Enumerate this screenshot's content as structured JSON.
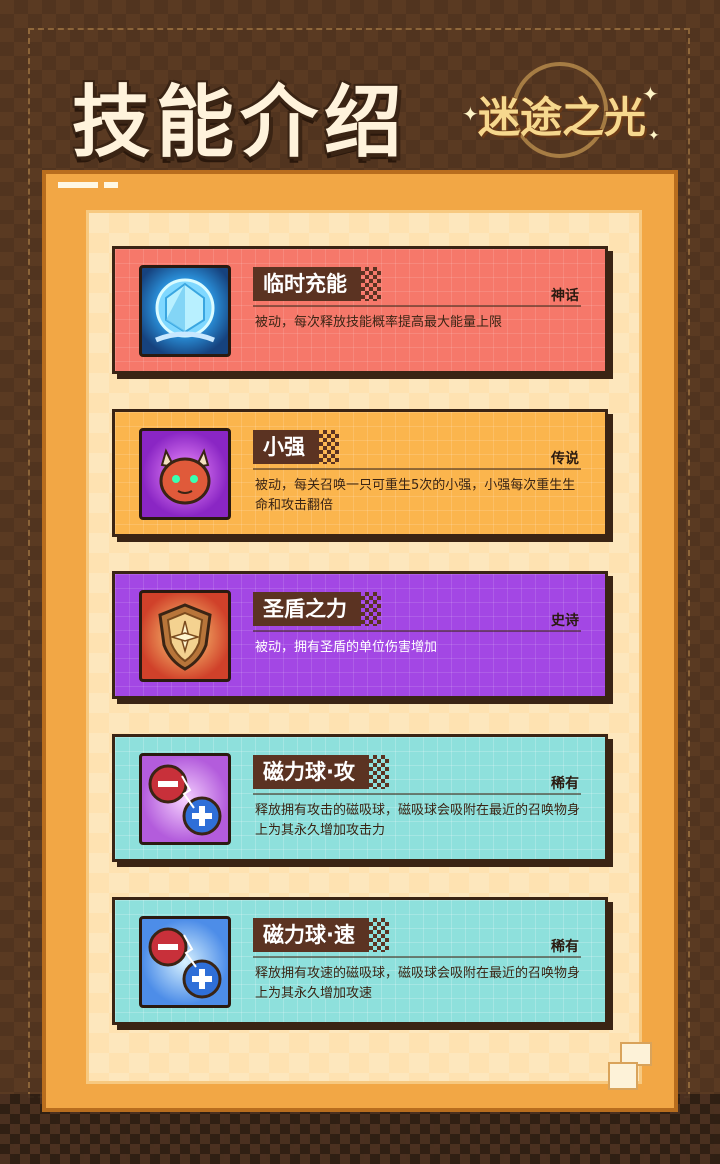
{
  "header": {
    "title": "技能介绍",
    "logo_text": "迷途之光"
  },
  "skills": [
    {
      "name": "临时充能",
      "rarity": "神话",
      "description": "被动，每次释放技能概率提高最大能量上限",
      "icon": "crystal-orb-icon"
    },
    {
      "name": "小强",
      "rarity": "传说",
      "description": "被动，每关召唤一只可重生5次的小强，小强每次重生生命和攻击翻倍",
      "icon": "horned-demon-icon"
    },
    {
      "name": "圣盾之力",
      "rarity": "史诗",
      "description": "被动，拥有圣盾的单位伤害增加",
      "icon": "holy-shield-icon"
    },
    {
      "name": "磁力球·攻",
      "rarity": "稀有",
      "description": "释放拥有攻击的磁吸球，磁吸球会吸附在最近的召唤物身上为其永久增加攻击力",
      "icon": "magnet-ball-attack-icon"
    },
    {
      "name": "磁力球·速",
      "rarity": "稀有",
      "description": "释放拥有攻速的磁吸球，磁吸球会吸附在最近的召唤物身上为其永久增加攻速",
      "icon": "magnet-ball-speed-icon"
    }
  ],
  "colors": {
    "mythic": "#f6786a",
    "legendary": "#fbb54d",
    "epic": "#a347e4",
    "rare": "#8ee0dc"
  }
}
